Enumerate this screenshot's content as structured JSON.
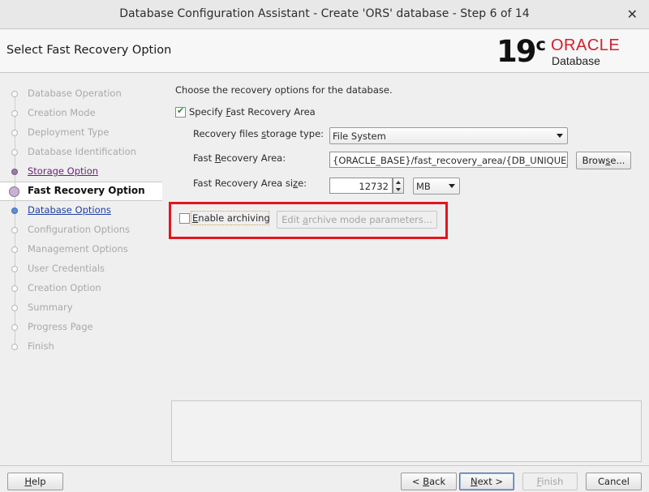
{
  "window": {
    "title": "Database Configuration Assistant - Create 'ORS' database - Step 6 of 14"
  },
  "header": {
    "page_title": "Select Fast Recovery Option",
    "logo": {
      "version": "19",
      "version_sup": "c",
      "brand": "ORACLE",
      "product": "Database"
    }
  },
  "steps": [
    {
      "label": "Database Operation",
      "state": "done"
    },
    {
      "label": "Creation Mode",
      "state": "done"
    },
    {
      "label": "Deployment Type",
      "state": "done"
    },
    {
      "label": "Database Identification",
      "state": "done"
    },
    {
      "label": "Storage Option",
      "state": "visited"
    },
    {
      "label": "Fast Recovery Option",
      "state": "current"
    },
    {
      "label": "Database Options",
      "state": "next"
    },
    {
      "label": "Configuration Options",
      "state": "pending"
    },
    {
      "label": "Management Options",
      "state": "pending"
    },
    {
      "label": "User Credentials",
      "state": "pending"
    },
    {
      "label": "Creation Option",
      "state": "pending"
    },
    {
      "label": "Summary",
      "state": "pending"
    },
    {
      "label": "Progress Page",
      "state": "pending"
    },
    {
      "label": "Finish",
      "state": "pending"
    }
  ],
  "main": {
    "intro": "Choose the recovery options for the database.",
    "specify_fra": {
      "pre": "Specify ",
      "mnemonic": "F",
      "post": "ast Recovery Area",
      "checked": true
    },
    "storage_type": {
      "pre": "Recovery files ",
      "mnemonic": "s",
      "post": "torage type:",
      "value": "File System"
    },
    "fra_location": {
      "pre": "Fast ",
      "mnemonic": "R",
      "post": "ecovery Area:",
      "value": "{ORACLE_BASE}/fast_recovery_area/{DB_UNIQUE_"
    },
    "browse": {
      "pre": "Brow",
      "mnemonic": "s",
      "post": "e..."
    },
    "fra_size": {
      "pre": "Fast Recovery Area si",
      "mnemonic": "z",
      "post": "e:",
      "value": "12732",
      "unit": "MB"
    },
    "archiving": {
      "pre": "",
      "mnemonic": "E",
      "post": "nable archiving",
      "checked": false
    },
    "edit_archive": {
      "pre": "Edit ",
      "mnemonic": "a",
      "post": "rchive mode parameters..."
    }
  },
  "footer": {
    "help": {
      "pre": "",
      "mnemonic": "H",
      "post": "elp"
    },
    "back": {
      "pre": "< ",
      "mnemonic": "B",
      "post": "ack"
    },
    "next": {
      "pre": "",
      "mnemonic": "N",
      "post": "ext >"
    },
    "finish": {
      "pre": "",
      "mnemonic": "F",
      "post": "inish"
    },
    "cancel": {
      "pre": "Cancel",
      "mnemonic": "",
      "post": ""
    }
  }
}
